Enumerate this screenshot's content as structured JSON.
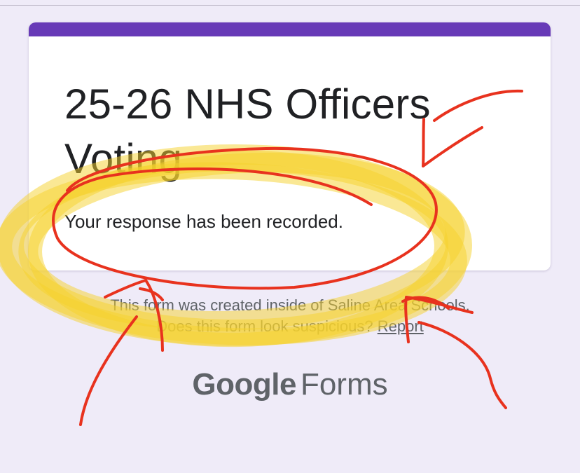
{
  "form": {
    "title": "25-26 NHS Officers Voting",
    "confirmation_message": "Your response has been recorded."
  },
  "footer": {
    "created_inside_text": "This form was created inside of Saline Area Schools.",
    "suspicious_prompt": "Does this form look suspicious?",
    "report_link_label": "Report"
  },
  "branding": {
    "google_label": "Google",
    "forms_label": "Forms"
  },
  "colors": {
    "accent": "#673ab7",
    "page_background": "#efebf8",
    "annotation_highlighter": "#f5d22c",
    "annotation_pen": "#e8321e"
  }
}
